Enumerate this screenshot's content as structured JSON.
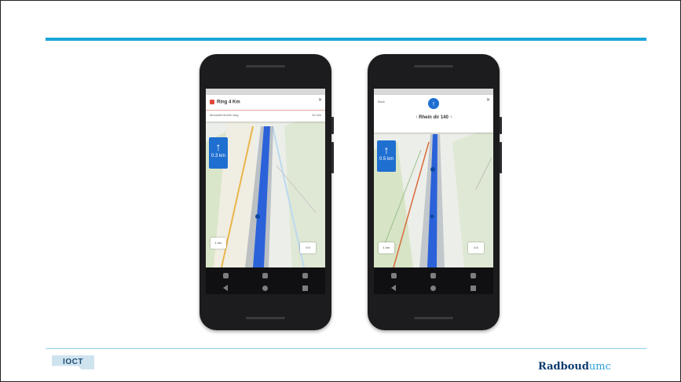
{
  "slide": {
    "accent_color": "#1aa6d9",
    "footer_logo_text": "IOCT",
    "brand_name_part1": "Radboud",
    "brand_name_part2": "umc"
  },
  "phone_left": {
    "top_card": {
      "title": "Ring 4 Km",
      "subtitle": "Mouseterrenthe weg",
      "right_info": "10 min"
    },
    "turn_card_label": "0.3 km",
    "chip_left": "1 km",
    "chip_right": "0.9"
  },
  "phone_right": {
    "top_card": {
      "left_label": "Back",
      "title": "↑ Rhein dir 140 ↑"
    },
    "turn_card_label": "0.5 km",
    "chip_left": "1 km",
    "chip_right": "0.5"
  },
  "colors": {
    "route_blue": "#2b62d9",
    "turn_card_blue": "#1f6fd1",
    "map_base": "#e9ece8"
  }
}
